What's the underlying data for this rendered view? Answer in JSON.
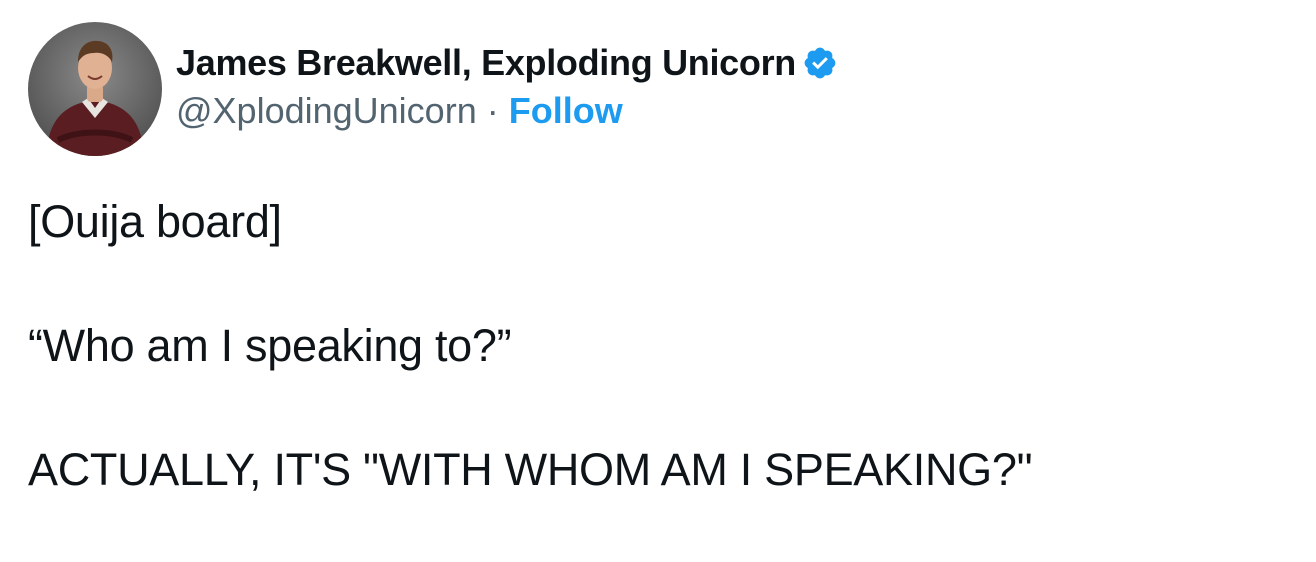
{
  "author": {
    "display_name": "James Breakwell, Exploding Unicorn",
    "handle": "@XplodingUnicorn",
    "separator": "·",
    "follow_label": "Follow",
    "verified": true,
    "verified_icon": "verified-badge-icon",
    "accent_color": "#1d9bf0"
  },
  "tweet": {
    "lines": [
      "[Ouija board]",
      "“Who am I speaking to?”",
      "ACTUALLY, IT'S \"WITH WHOM AM I SPEAKING?\""
    ]
  }
}
